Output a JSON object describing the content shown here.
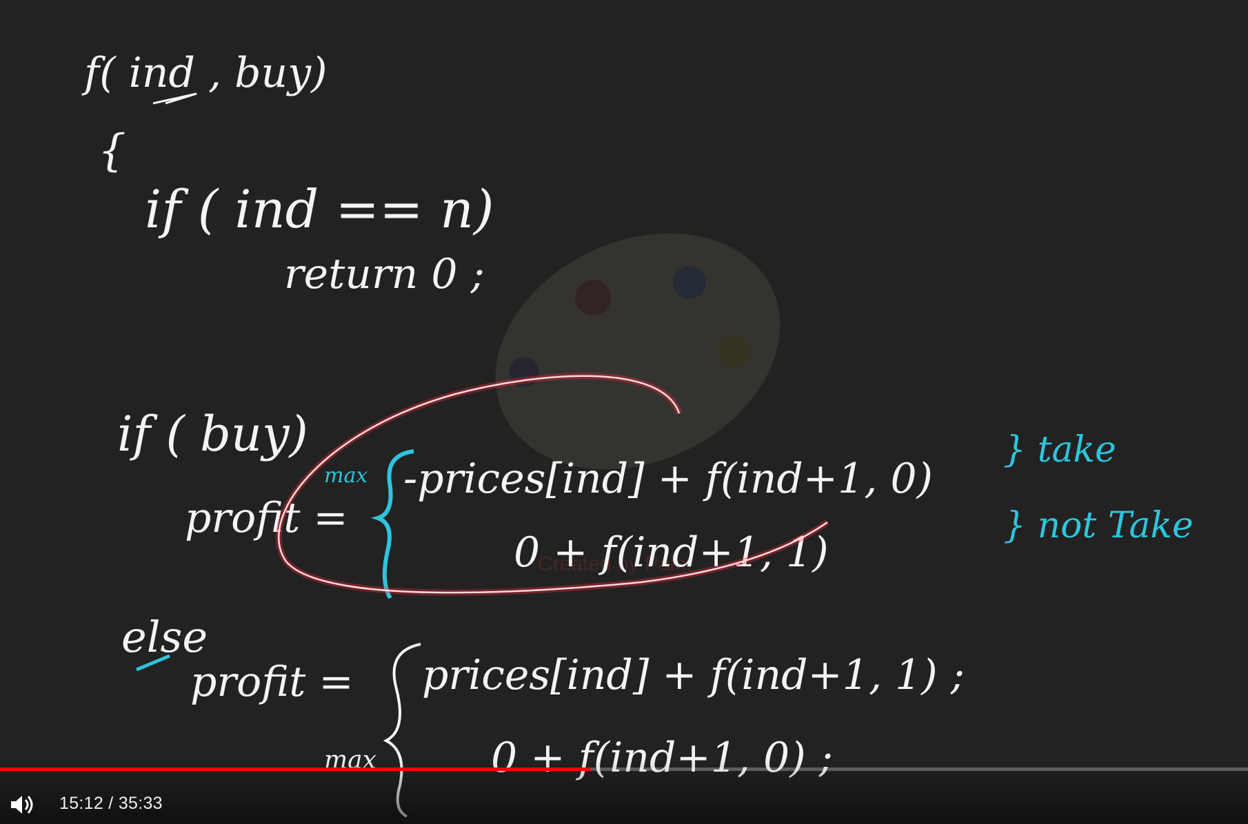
{
  "player": {
    "current_time": "15:12",
    "separator": " / ",
    "duration": "35:33",
    "progress_fraction": 0.473,
    "volume_icon": "volume-icon",
    "accent_color": "#ff0000"
  },
  "whiteboard": {
    "ink_color": "#f4f4f4",
    "annotation_color": "#2ec5dc",
    "highlight_color": "#ff2a3a",
    "lines": {
      "signature": "f( ind , buy)",
      "open_brace": "{",
      "base_if": "if ( ind == n)",
      "base_return": "return 0 ;",
      "if_buy": "if ( buy)",
      "profit1_lhs": "profit =",
      "profit1_max": "max",
      "profit1_row1": "-prices[ind] + f(ind+1, 0)",
      "profit1_row1_note": "} take",
      "profit1_row2": "0   + f(ind+1, 1)",
      "profit1_row2_note": "} not Take",
      "else": "else",
      "profit2_lhs": "profit =",
      "profit2_row1": "prices[ind] + f(ind+1, 1) ;",
      "profit2_max": "max",
      "profit2_row2": "0   + f(ind+1, 0) ;"
    },
    "watermark": "Created by Paint"
  }
}
